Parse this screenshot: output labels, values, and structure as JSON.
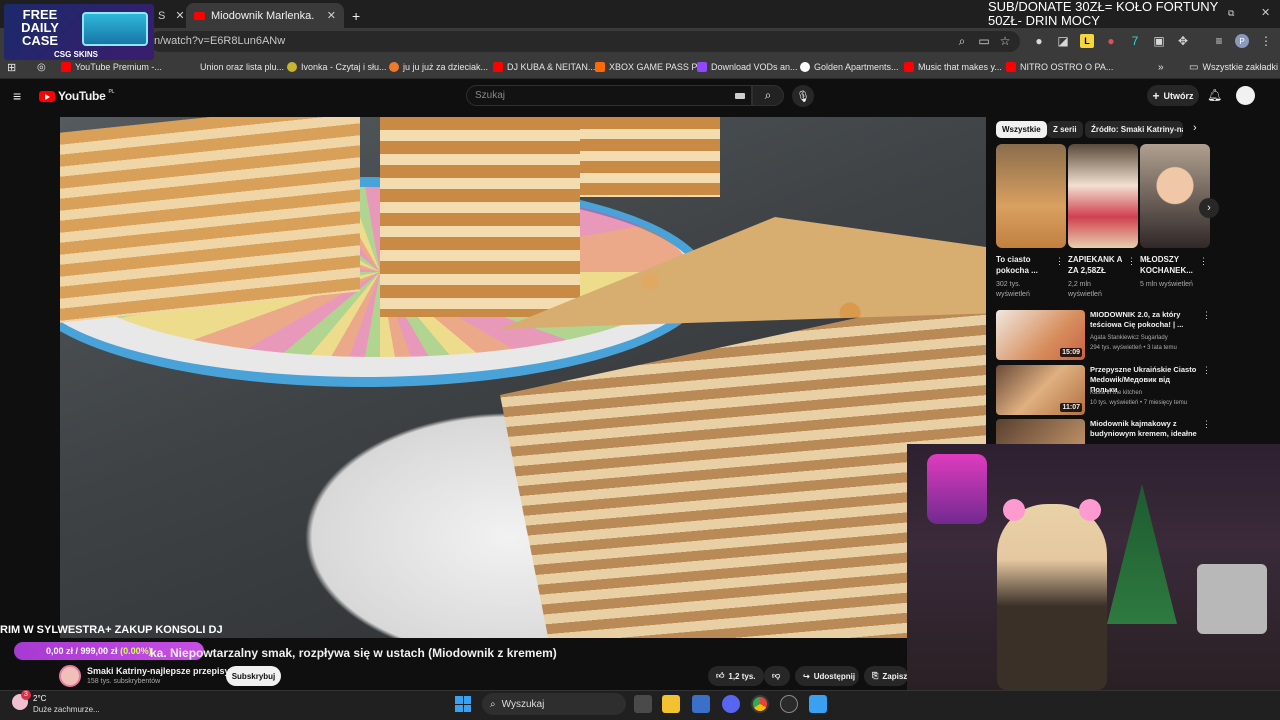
{
  "overlay": {
    "promo_text": "FREE DAILY CASE",
    "promo_sub": "CSG SKINS",
    "donate_line1": "SUB/DONATE 30ZŁ= KOŁO FORTUNY",
    "donate_line2": "50ZŁ- DRIN MOCY",
    "stream_title": "RIM W SYLWESTRA+ ZAKUP KONSOLI DJ",
    "goal_amount": "0,00 zł / 999,00 zł",
    "goal_pct": "(0.00%)"
  },
  "browser": {
    "tabs": [
      {
        "label": "Miodownik Marlenka. Niepowt",
        "active": true
      }
    ],
    "url": "n/watch?v=E6R8Lun6ANw",
    "bookmarks": [
      {
        "label": "YouTube Premium -...",
        "icon": "youtube-icon",
        "color": "#ff0000"
      },
      {
        "label": "Union oraz lista plu...",
        "icon": "generic-icon",
        "color": "#3a3a3a"
      },
      {
        "label": "Ivonka - Czytaj i słu...",
        "icon": "leaf-icon",
        "color": "#c8b431"
      },
      {
        "label": "ju ju już za dzieciak...",
        "icon": "ball-icon",
        "color": "#f07a2a"
      },
      {
        "label": "DJ KUBA & NEITAN...",
        "icon": "youtube-icon",
        "color": "#ff0000"
      },
      {
        "label": "XBOX GAME PASS P...",
        "icon": "amazon-icon",
        "color": "#ff6a00"
      },
      {
        "label": "Download VODs an...",
        "icon": "twitch-icon",
        "color": "#9146ff"
      },
      {
        "label": "Golden Apartments...",
        "icon": "globe-icon",
        "color": "#ffffff"
      },
      {
        "label": "Music that makes y...",
        "icon": "youtube-icon",
        "color": "#ff0000"
      },
      {
        "label": "NITRO OSTRO O PA...",
        "icon": "youtube-icon",
        "color": "#ff0000"
      }
    ],
    "all_bookmarks": "Wszystkie zakładki"
  },
  "youtube": {
    "logo_text": "YouTube",
    "logo_sup": "PL",
    "search_placeholder": "Szukaj",
    "create_label": "Utwórz",
    "video_title": "ka. Niepowtarzalny smak, rozpływa się w ustach (Miodownik z kremem)",
    "channel_name": "Smaki Katriny-najlepsze przepisy",
    "channel_subs": "158 tys. subskrybentów",
    "subscribe_label": "Subskrybuj",
    "likes": "1,2 tys.",
    "share_label": "Udostępnij",
    "save_label": "Zapisz",
    "chips": [
      "Wszystkie",
      "Z serii",
      "Źródło: Smaki Katriny-najle"
    ],
    "shorts": [
      {
        "title": "To ciasto pokocha ...",
        "views": "302 tys. wyświetleń"
      },
      {
        "title": "ZAPIEKANK A ZA 2,58ZŁ",
        "views": "2,2 mln wyświetleń"
      },
      {
        "title": "MŁODSZY KOCHANEK...",
        "views": "5 mln wyświetleń"
      }
    ],
    "recommended": [
      {
        "title": "MIODOWNIK 2.0, za który teściowa Cię pokocha! | ...",
        "channel": "Agata Stankiewicz Sugarlady",
        "meta": "294 tys. wyświetleń • 3 lata temu",
        "duration": "15:09"
      },
      {
        "title": "Przepyszne Ukraińskie Ciasto Medowik/Медовик від Польки",
        "channel": "Kasia in the kitchen",
        "meta": "10 tys. wyświetleń • 7 miesięcy temu",
        "duration": "11:07"
      },
      {
        "title": "Miodownik kajmakowy z budyniowym kremem, ideałne ...",
        "channel": "",
        "meta": "",
        "duration": ""
      }
    ]
  },
  "taskbar": {
    "temp": "2°C",
    "weather": "Duże zachmurze...",
    "badge": "3",
    "search_label": "Wyszukaj"
  }
}
